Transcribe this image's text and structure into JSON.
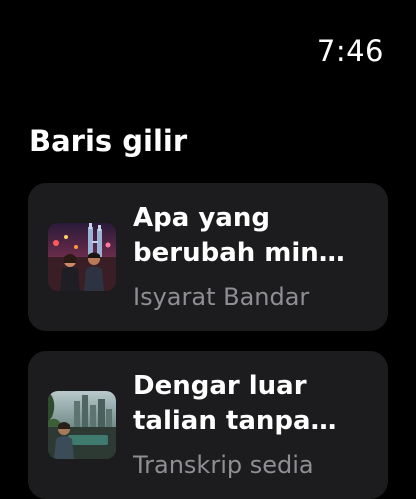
{
  "status_bar": {
    "time": "7:46"
  },
  "section": {
    "title": "Baris gilir"
  },
  "queue": [
    {
      "title": "Apa yang berubah min…",
      "subtitle": "Isyarat Bandar",
      "artwork": "city-night-couple-artwork"
    },
    {
      "title": "Dengar luar talian tanpa…",
      "subtitle": "Transkrip sedia",
      "artwork": "city-skyline-listener-artwork"
    }
  ]
}
